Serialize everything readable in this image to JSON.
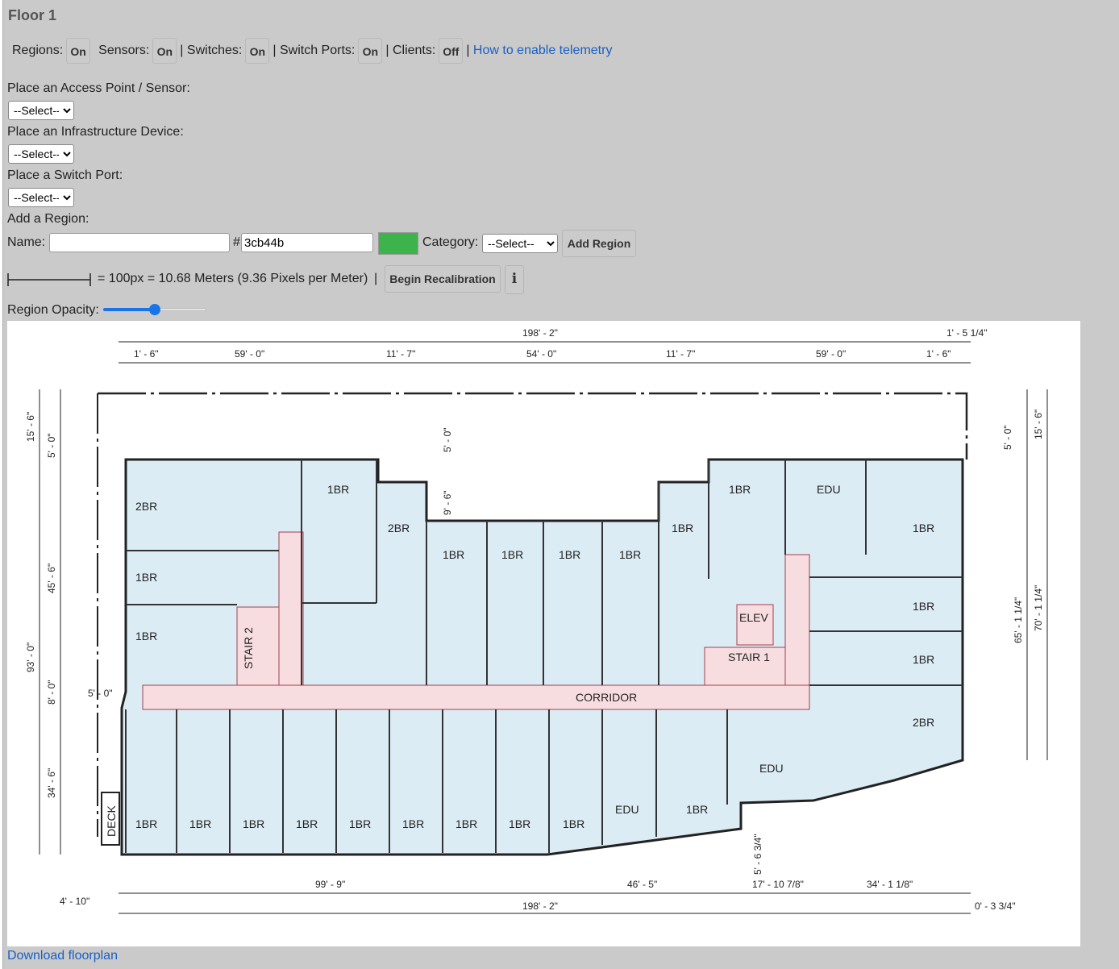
{
  "floor_title": "Floor 1",
  "toggles": {
    "regions_label": "Regions:",
    "regions_value": "On",
    "sensors_label": "Sensors:",
    "sensors_value": "On",
    "sep1": "|",
    "switches_label": "Switches:",
    "switches_value": "On",
    "sep2": "|",
    "switch_ports_label": "Switch Ports:",
    "switch_ports_value": "On",
    "sep3": "|",
    "clients_label": "Clients:",
    "clients_value": "Off",
    "sep4": "|",
    "telemetry_link": "How to enable telemetry"
  },
  "place_ap": {
    "label": "Place an Access Point / Sensor:",
    "selected": "--Select--"
  },
  "place_infra": {
    "label": "Place an Infrastructure Device:",
    "selected": "--Select--"
  },
  "place_port": {
    "label": "Place a Switch Port:",
    "selected": "--Select--"
  },
  "add_region": {
    "label": "Add a Region:",
    "name_label": "Name:",
    "name_value": "",
    "hash": "#",
    "color_value": "3cb44b",
    "color_hex": "#3cb44b",
    "category_label": "Category:",
    "category_selected": "--Select--",
    "add_button": "Add Region"
  },
  "scale": {
    "text": "= 100px = 10.68 Meters (9.36 Pixels per Meter)",
    "sep": "|",
    "recalibrate_button": "Begin Recalibration",
    "info_button": "i"
  },
  "opacity": {
    "label": "Region Opacity:",
    "value_fraction": 0.5
  },
  "floorplan": {
    "rooms": {
      "r_2br_nw": "2BR",
      "r_1br_n1": "1BR",
      "r_2br_n2": "2BR",
      "r_1br_w1": "1BR",
      "r_1br_w2": "1BR",
      "r_1br_c1": "1BR",
      "r_1br_c2": "1BR",
      "r_1br_c3": "1BR",
      "r_1br_c4": "1BR",
      "r_1br_c5": "1BR",
      "r_1br_ne1": "1BR",
      "r_edu_ne": "EDU",
      "r_1br_ne2": "1BR",
      "r_1br_e1": "1BR",
      "r_1br_e2": "1BR",
      "r_2br_se": "2BR",
      "r_edu_s1": "EDU",
      "r_edu_s2": "EDU",
      "r_1br_s9": "1BR",
      "bottom_row": [
        "1BR",
        "1BR",
        "1BR",
        "1BR",
        "1BR",
        "1BR",
        "1BR",
        "1BR",
        "1BR"
      ],
      "stair2": "STAIR 2",
      "stair1": "STAIR 1",
      "elev": "ELEV",
      "corridor": "CORRIDOR",
      "deck": "DECK"
    },
    "dims": {
      "top_total": "198' - 2\"",
      "top_right": "1' - 5 1/4\"",
      "top_segments": [
        "1' - 6\"",
        "59' - 0\"",
        "11' - 7\"",
        "54' - 0\"",
        "11' - 7\"",
        "59' - 0\"",
        "1' - 6\""
      ],
      "left_15_6": "15' - 6\"",
      "left_5_0": "5' - 0\"",
      "left_45_6": "45' - 6\"",
      "left_93_0": "93' - 0\"",
      "left_8_0": "8' - 0\"",
      "left_5_0b": "5' - 0\"",
      "left_34_6": "34' - 6\"",
      "mid_5_0": "5' - 0\"",
      "mid_9_6": "9' - 6\"",
      "right_5_0": "5' - 0\"",
      "right_15_6": "15' - 6\"",
      "right_65": "65' - 1 1/4\"",
      "right_70": "70' - 1 1/4\"",
      "bot_99_9": "99' - 9\"",
      "bot_46_5": "46' - 5\"",
      "bot_17": "17' - 10 7/8\"",
      "bot_34": "34' - 1 1/8\"",
      "bot_5_6": "5' - 6 3/4\"",
      "bot_total": "198' - 2\"",
      "bot_4_10": "4' - 10\"",
      "bot_0_3": "0' - 3 3/4\""
    }
  },
  "download_link": "Download floorplan"
}
